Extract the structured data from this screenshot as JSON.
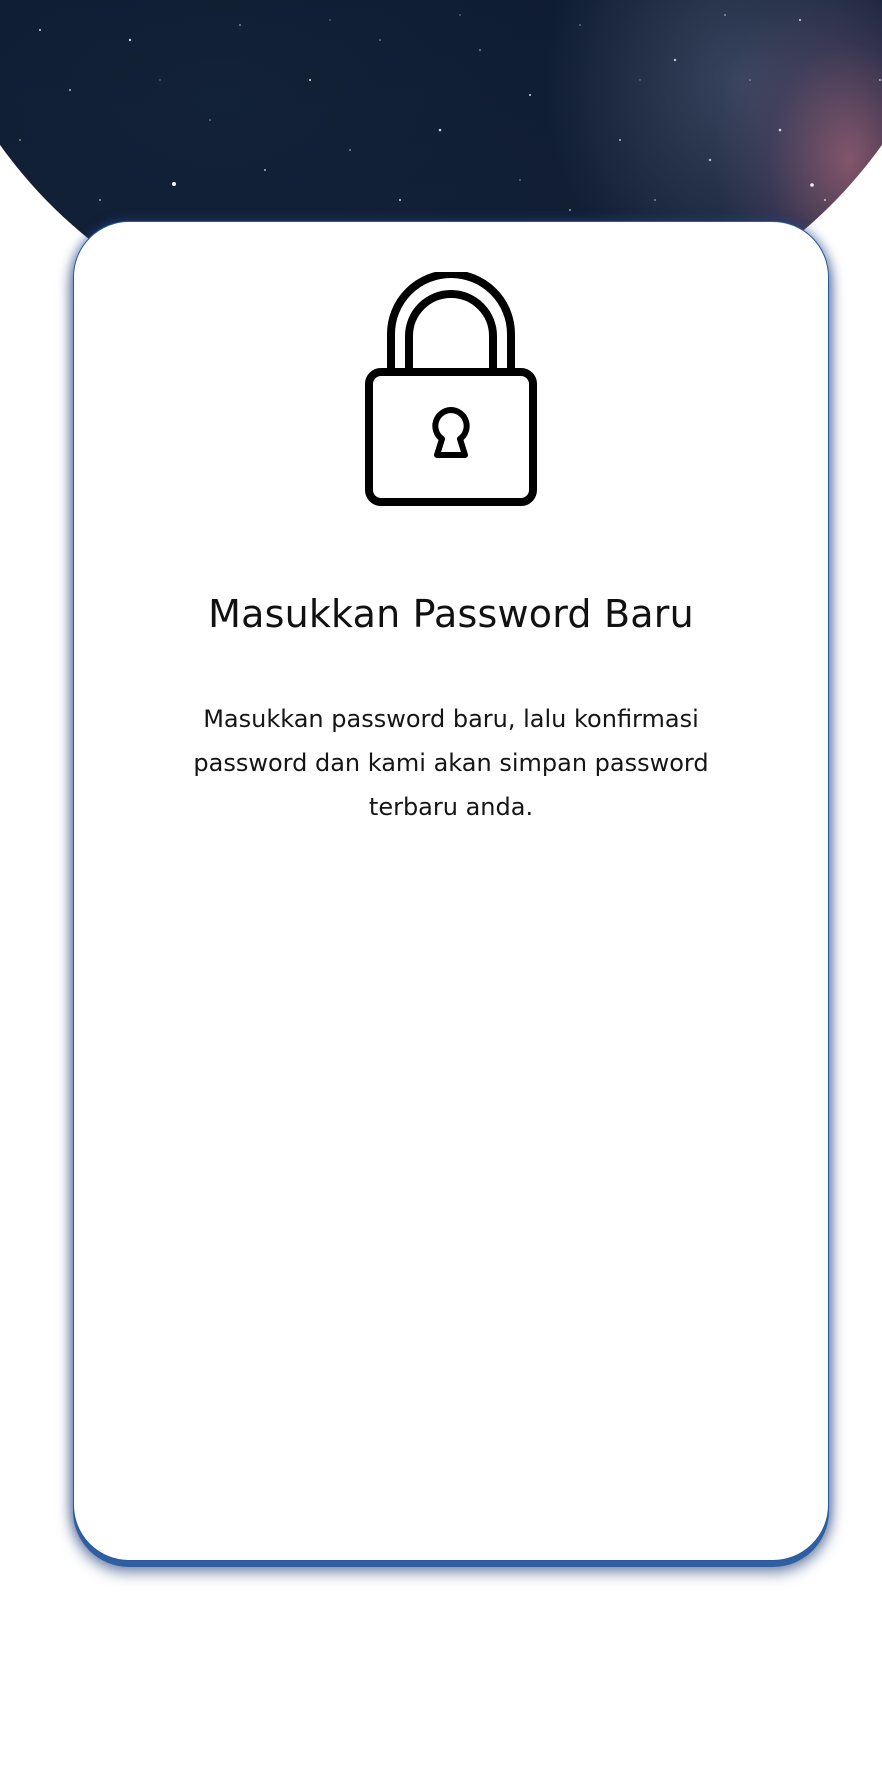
{
  "reset_password": {
    "title": "Masukkan Password Baru",
    "description": "Masukkan password baru, lalu konfirmasi password dan kami akan simpan password terbaru anda."
  },
  "icons": {
    "hero": "lock-icon"
  },
  "colors": {
    "space_background": "#0e1c31",
    "card_background": "#ffffff",
    "card_border": "#2a5a9c",
    "text": "#111111"
  }
}
